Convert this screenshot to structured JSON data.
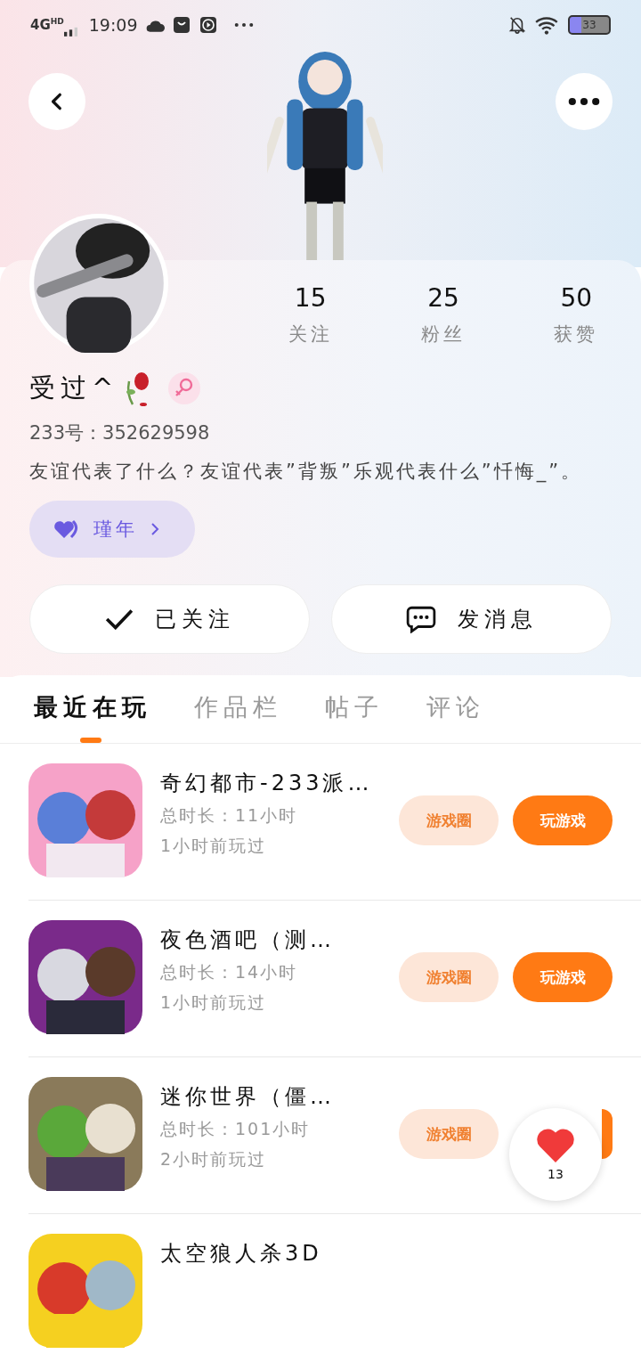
{
  "status_bar": {
    "network": "4G",
    "network_badge": "HD",
    "time": "19:09",
    "battery": "33"
  },
  "profile": {
    "stats": [
      {
        "value": "15",
        "label": "关注"
      },
      {
        "value": "25",
        "label": "粉丝"
      },
      {
        "value": "50",
        "label": "获赞"
      }
    ],
    "name": "受过^",
    "id_line": "233号：352629598",
    "bio": "友谊代表了什么？友谊代表”背叛”乐观代表什么”忏悔_”。",
    "badge": "瑾年",
    "follow_button": {
      "label": "已关注",
      "followed": true
    },
    "message_button": "发消息"
  },
  "tabs": [
    {
      "label": "最近在玩",
      "selected": true
    },
    {
      "label": "作品栏",
      "selected": false
    },
    {
      "label": "帖子",
      "selected": false
    },
    {
      "label": "评论",
      "selected": false
    }
  ],
  "games": [
    {
      "title": "奇幻都市-233派…",
      "duration": "总时长：11小时",
      "last_played": "1小时前玩过",
      "circle_button": "游戏圈",
      "play_button": "玩游戏"
    },
    {
      "title": "夜色酒吧（测…",
      "duration": "总时长：14小时",
      "last_played": "1小时前玩过",
      "circle_button": "游戏圈",
      "play_button": "玩游戏"
    },
    {
      "title": "迷你世界（僵…",
      "duration": "总时长：101小时",
      "last_played": "2小时前玩过",
      "circle_button": "游戏圈"
    },
    {
      "title": "太空狼人杀3D"
    }
  ],
  "like_float": {
    "count": "13"
  }
}
